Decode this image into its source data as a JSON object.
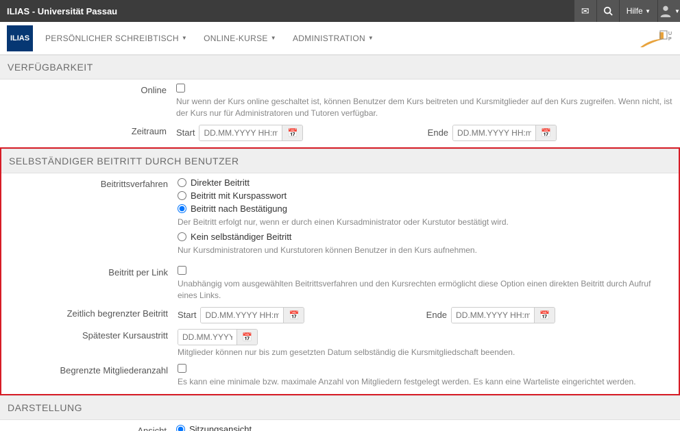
{
  "topbar": {
    "title": "ILIAS - Universität Passau",
    "help_label": "Hilfe"
  },
  "nav": {
    "logo_text": "ILIAS",
    "items": [
      "PERSÖNLICHER SCHREIBTISCH",
      "ONLINE-KURSE",
      "ADMINISTRATION"
    ]
  },
  "sections": {
    "availability": {
      "title": "VERFÜGBARKEIT",
      "online_label": "Online",
      "online_help": "Nur wenn der Kurs online geschaltet ist, können Benutzer dem Kurs beitreten und Kursmitglieder auf den Kurs zugreifen. Wenn nicht, ist der Kurs nur für Administratoren und Tutoren verfügbar.",
      "period_label": "Zeitraum",
      "start_label": "Start",
      "end_label": "Ende",
      "dt_placeholder": "DD.MM.YYYY HH:mm"
    },
    "registration": {
      "title": "SELBSTÄNDIGER BEITRITT DURCH BENUTZER",
      "procedure_label": "Beitrittsverfahren",
      "opt_direct": "Direkter Beitritt",
      "opt_password": "Beitritt mit Kurspasswort",
      "opt_confirm": "Beitritt nach Bestätigung",
      "opt_confirm_help": "Der Beitritt erfolgt nur, wenn er durch einen Kursadministrator oder Kurstutor bestätigt wird.",
      "opt_none": "Kein selbständiger Beitritt",
      "opt_none_help": "Nur Kursdministratoren und Kurstutoren können Benutzer in den Kurs aufnehmen.",
      "link_label": "Beitritt per Link",
      "link_help": "Unabhängig vom ausgewählten Beitrittsverfahren und den Kursrechten ermöglicht diese Option einen direkten Beitritt durch Aufruf eines Links.",
      "timed_label": "Zeitlich begrenzter Beitritt",
      "start_label": "Start",
      "end_label": "Ende",
      "dt_placeholder": "DD.MM.YYYY HH:mm",
      "exit_label": "Spätester Kursaustritt",
      "exit_placeholder": "DD.MM.YYYY",
      "exit_help": "Mitglieder können nur bis zum gesetzten Datum selbständig die Kursmitgliedschaft beenden.",
      "limit_label": "Begrenzte Mitgliederanzahl",
      "limit_help": "Es kann eine minimale bzw. maximale Anzahl von Mitgliedern festgelegt werden. Es kann eine Warteliste eingerichtet werden."
    },
    "presentation": {
      "title": "DARSTELLUNG",
      "view_label": "Ansicht",
      "opt_sessions": "Sitzungsansicht"
    }
  }
}
